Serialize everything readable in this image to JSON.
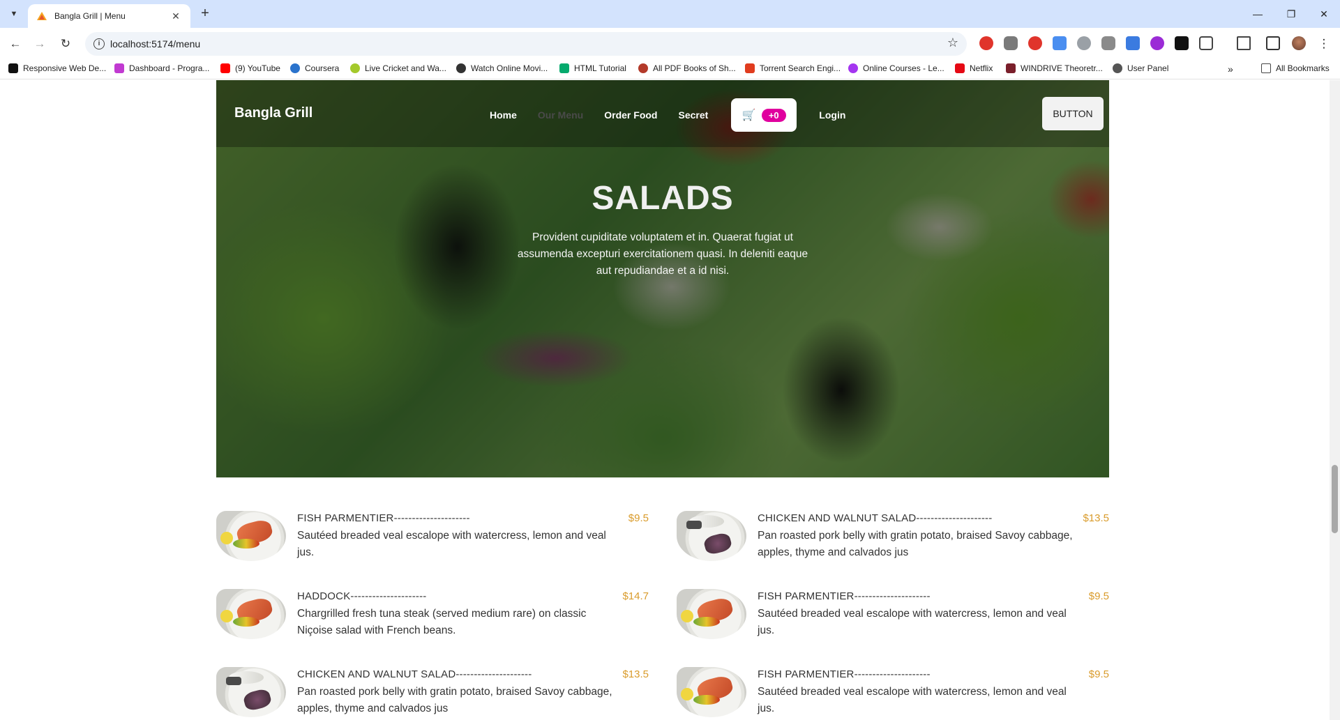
{
  "browser": {
    "tab_title": "Bangla Grill | Menu",
    "url": "localhost:5174/menu",
    "bookmarks": [
      {
        "label": "Responsive Web De...",
        "color": "#111111"
      },
      {
        "label": "Dashboard - Progra...",
        "color": "#c13ad1"
      },
      {
        "label": "(9) YouTube",
        "color": "#ff0000"
      },
      {
        "label": "Coursera",
        "color": "#2a73cc"
      },
      {
        "label": "Live Cricket and Wa...",
        "color": "#a4c92b"
      },
      {
        "label": "Watch Online Movi...",
        "color": "#333333"
      },
      {
        "label": "HTML Tutorial",
        "color": "#04aa6d"
      },
      {
        "label": "All PDF Books of Sh...",
        "color": "#b33a2a"
      },
      {
        "label": "Torrent Search Engi...",
        "color": "#e03c1e"
      },
      {
        "label": "Online Courses - Le...",
        "color": "#a435f0"
      },
      {
        "label": "Netflix",
        "color": "#e50914"
      },
      {
        "label": "WINDRIVE Theoretr...",
        "color": "#7a1f2b"
      },
      {
        "label": "User Panel",
        "color": "#555555"
      }
    ],
    "all_bookmarks_label": "All Bookmarks"
  },
  "navbar": {
    "brand": "Bangla Grill",
    "links": [
      "Home",
      "Our Menu",
      "Order Food",
      "Secret"
    ],
    "cart_count": "+0",
    "login_label": "Login",
    "button_label": "BUTTON"
  },
  "hero": {
    "title": "SALADS",
    "text": "Provident cupiditate voluptatem et in. Quaerat fugiat ut assumenda excepturi exercitationem quasi. In deleniti eaque aut repudiandae et a id nisi."
  },
  "menu_items": [
    {
      "name": "FISH PARMENTIER---------------------",
      "price": "$9.5",
      "description": "Sautéed breaded veal escalope with watercress, lemon and veal jus."
    },
    {
      "name": "CHICKEN AND WALNUT SALAD---------------------",
      "price": "$13.5",
      "description": "Pan roasted pork belly with gratin potato, braised Savoy cabbage, apples, thyme and calvados jus"
    },
    {
      "name": "HADDOCK---------------------",
      "price": "$14.7",
      "description": "Chargrilled fresh tuna steak (served medium rare) on classic Niçoise salad with French beans."
    },
    {
      "name": "FISH PARMENTIER---------------------",
      "price": "$9.5",
      "description": "Sautéed breaded veal escalope with watercress, lemon and veal jus."
    },
    {
      "name": "CHICKEN AND WALNUT SALAD---------------------",
      "price": "$13.5",
      "description": "Pan roasted pork belly with gratin potato, braised Savoy cabbage, apples, thyme and calvados jus"
    },
    {
      "name": "FISH PARMENTIER---------------------",
      "price": "$9.5",
      "description": "Sautéed breaded veal escalope with watercress, lemon and veal jus."
    }
  ],
  "colors": {
    "accent": "#d99b2b",
    "cart_badge": "#e0009e",
    "chrome_tabbar": "#d3e3fd"
  }
}
